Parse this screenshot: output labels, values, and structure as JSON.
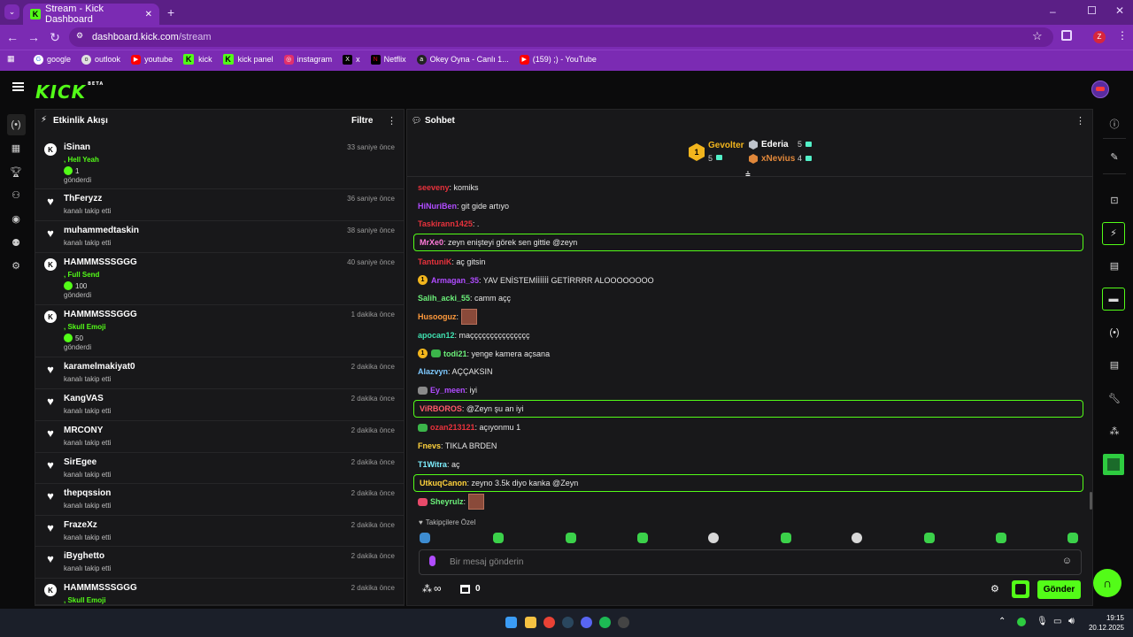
{
  "browser": {
    "tab_title": "Stream - Kick Dashboard",
    "url_domain": "dashboard.kick.com",
    "url_path": "/stream",
    "profile_initial": "Z",
    "bookmarks": [
      "google",
      "outlook",
      "youtube",
      "kick",
      "kick panel",
      "instagram",
      "x",
      "Netflix",
      "Okey Oyna - Canlı 1...",
      "(159) ;) - YouTube"
    ]
  },
  "kick": {
    "logo": "KICK",
    "beta": "BETA"
  },
  "activity": {
    "title": "Etkinlik Akışı",
    "filter": "Filtre",
    "events": [
      {
        "name": "iSinan",
        "time": "33 saniye önce",
        "type": "gift",
        "reward": ", Hell Yeah",
        "amount": "1",
        "action": "gönderdi"
      },
      {
        "name": "ThFeryzz",
        "time": "36 saniye önce",
        "type": "follow",
        "action": "kanalı takip etti"
      },
      {
        "name": "muhammedtaskin",
        "time": "38 saniye önce",
        "type": "follow",
        "action": "kanalı takip etti"
      },
      {
        "name": "HAMMMSSSGGG",
        "time": "40 saniye önce",
        "type": "gift",
        "reward": ", Full Send",
        "amount": "100",
        "action": "gönderdi"
      },
      {
        "name": "HAMMMSSSGGG",
        "time": "1 dakika önce",
        "type": "gift",
        "reward": ", Skull Emoji",
        "amount": "50",
        "action": "gönderdi"
      },
      {
        "name": "karamelmakiyat0",
        "time": "2 dakika önce",
        "type": "follow",
        "action": "kanalı takip etti"
      },
      {
        "name": "KangVAS",
        "time": "2 dakika önce",
        "type": "follow",
        "action": "kanalı takip etti"
      },
      {
        "name": "MRCONY",
        "time": "2 dakika önce",
        "type": "follow",
        "action": "kanalı takip etti"
      },
      {
        "name": "SirEgee",
        "time": "2 dakika önce",
        "type": "follow",
        "action": "kanalı takip etti"
      },
      {
        "name": "thepqssion",
        "time": "2 dakika önce",
        "type": "follow",
        "action": "kanalı takip etti"
      },
      {
        "name": "FrazeXz",
        "time": "2 dakika önce",
        "type": "follow",
        "action": "kanalı takip etti"
      },
      {
        "name": "iByghetto",
        "time": "2 dakika önce",
        "type": "follow",
        "action": "kanalı takip etti"
      },
      {
        "name": "HAMMMSSSGGG",
        "time": "2 dakika önce",
        "type": "gift",
        "reward": ", Skull Emoji",
        "amount": "",
        "action": ""
      }
    ]
  },
  "chat": {
    "title": "Sohbet",
    "leaderboard": [
      {
        "rank": "1",
        "name": "Gevolter",
        "count": "5"
      },
      {
        "name": "Ederia",
        "count": "5"
      },
      {
        "name": "xNevius",
        "count": "4"
      }
    ],
    "messages": [
      {
        "user": "seeveny",
        "color": "#e8323c",
        "text": ": komiks"
      },
      {
        "user": "HiNuriBen",
        "color": "#b04cff",
        "text": ": git gide artıyo"
      },
      {
        "user": "Taskirann1425",
        "color": "#e8323c",
        "text": ": ."
      },
      {
        "user": "MrXe0",
        "color": "#ff7ad9",
        "text": ": zeyn enişteyi görek sen gittie @zeyn",
        "hl": true
      },
      {
        "user": "TantuniK",
        "color": "#e8323c",
        "text": ": aç gitsin"
      },
      {
        "user": "Armagan_35",
        "color": "#b04cff",
        "text": ": YAV ENİSTEMİİİİİİ GETİRRRR ALOOOOOOOO",
        "badge": "1"
      },
      {
        "user": "Salih_acki_55",
        "color": "#6cf07a",
        "text": ": camm açç"
      },
      {
        "user": "Husooguz",
        "color": "#ff9a3c",
        "text": ":",
        "emote": true
      },
      {
        "user": "apocan12",
        "color": "#3fe0b0",
        "text": ": maççççççççççççççç"
      },
      {
        "user": "todi21",
        "color": "#6cf07a",
        "text": ": yenge kamera açsana",
        "badge": "1"
      },
      {
        "user": "Alazvyn",
        "color": "#7ec9ff",
        "text": ": AÇÇAKSIN"
      },
      {
        "user": "Ey_meen",
        "color": "#b04cff",
        "text": ": iyi"
      },
      {
        "user": "ViRBOROS",
        "color": "#ff5a6a",
        "text": ": @Zeyn şu an iyi",
        "hl": true
      },
      {
        "user": "ozan213121",
        "color": "#e8323c",
        "text": ": açıyonmu 1"
      },
      {
        "user": "Fnevs",
        "color": "#ffd23c",
        "text": ": TIKLA BRDEN"
      },
      {
        "user": "T1Witra",
        "color": "#7ef0ff",
        "text": ": aç"
      },
      {
        "user": "UtkuqCanon",
        "color": "#ffd23c",
        "text": ": zeyno 3.5k diyo kanka @Zeyn",
        "hl": true
      },
      {
        "user": "Sheyrulz",
        "color": "#6cf07a",
        "text": ":",
        "emote": true
      }
    ],
    "followers_only": "Takipçilere Özel",
    "input_placeholder": "Bir mesaj gönderin",
    "infinity": "∞",
    "shop_count": "0",
    "send": "Gönder"
  },
  "taskbar": {
    "time": "19:15",
    "date": "20.12.2025"
  }
}
